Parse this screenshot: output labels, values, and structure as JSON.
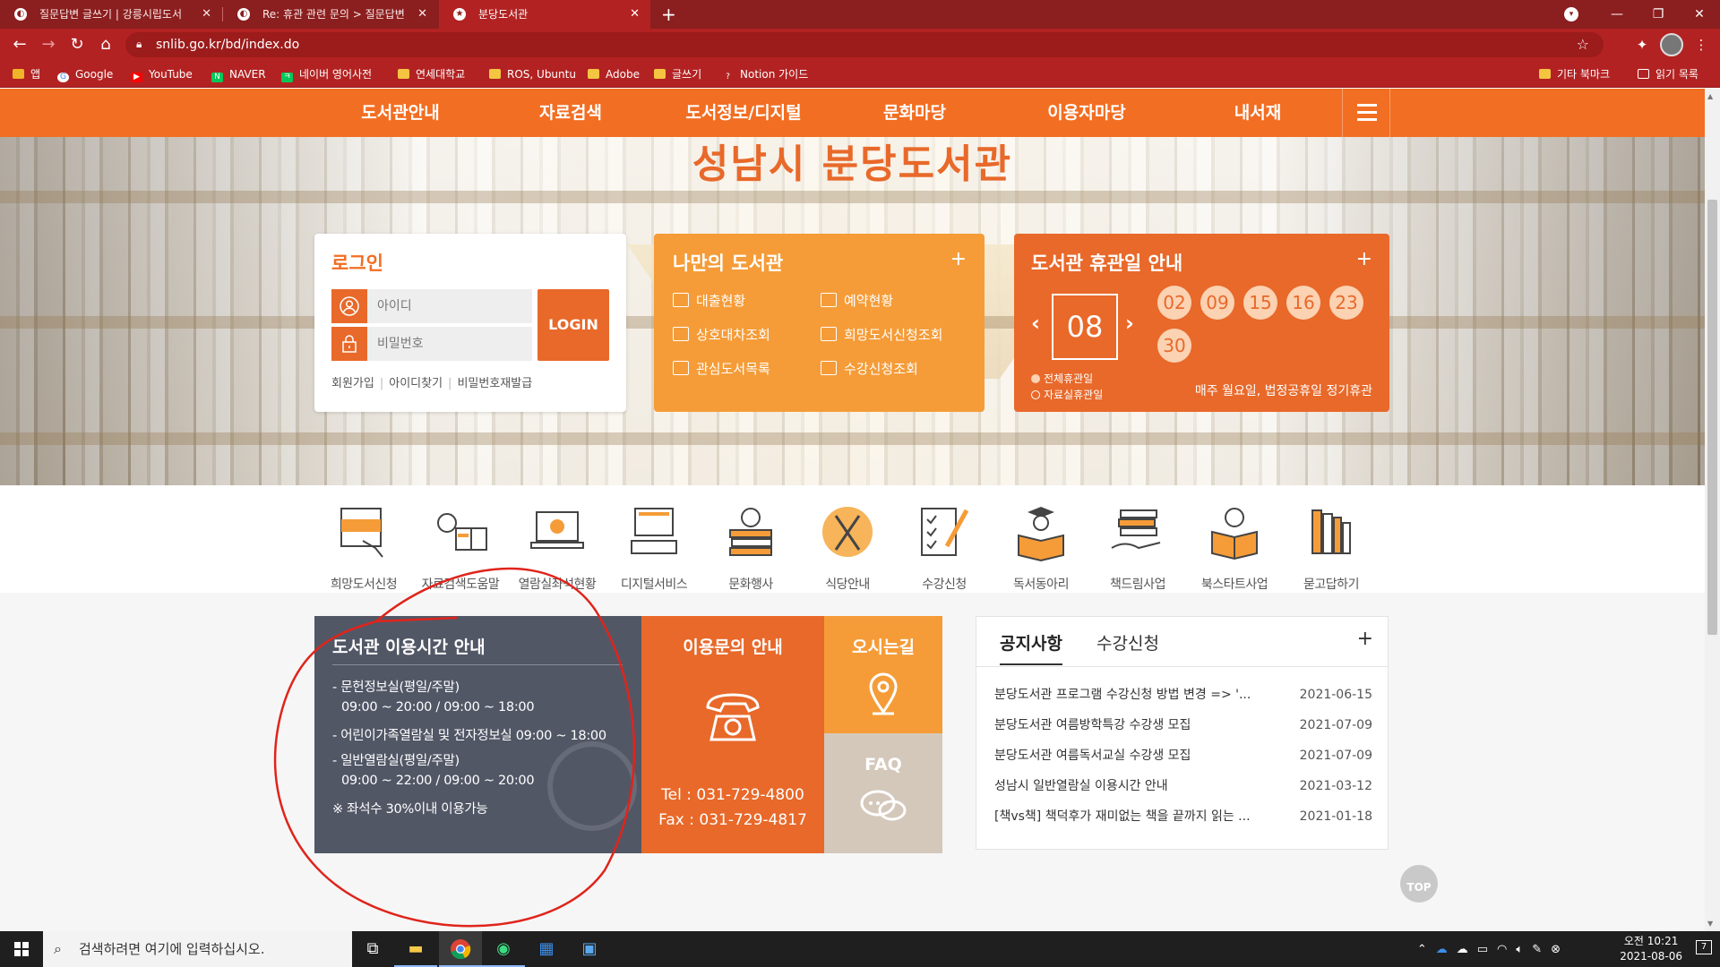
{
  "browser": {
    "tabs": [
      {
        "title": "질문답변 글쓰기 | 강릉시립도서",
        "active": false
      },
      {
        "title": "Re: 휴관 관련 문의 > 질문답변",
        "active": false
      },
      {
        "title": "분당도서관",
        "active": true
      }
    ],
    "url": "snlib.go.kr/bd/index.do",
    "bookmarks": [
      "앱",
      "Google",
      "YouTube",
      "NAVER",
      "네이버 영어사전",
      "연세대학교",
      "ROS, Ubuntu",
      "Adobe",
      "글쓰기",
      "Notion 가이드"
    ],
    "bookmarks_right": [
      "기타 북마크",
      "읽기 목록"
    ]
  },
  "site": {
    "title": "성남시 분당도서관",
    "nav": [
      "도서관안내",
      "자료검색",
      "도서정보/디지털",
      "문화마당",
      "이용자마당",
      "내서재"
    ]
  },
  "login": {
    "title": "로그인",
    "id_placeholder": "아이디",
    "pw_placeholder": "비밀번호",
    "button": "LOGIN",
    "links": [
      "회원가입",
      "아이디찾기",
      "비밀번호재발급"
    ]
  },
  "mylib": {
    "title": "나만의 도서관",
    "plus": "+",
    "links": [
      "대출현황",
      "예약현황",
      "상호대차조회",
      "희망도서신청조회",
      "관심도서목록",
      "수강신청조회"
    ]
  },
  "holiday": {
    "title": "도서관 휴관일 안내",
    "plus": "+",
    "month": "08",
    "days": [
      "02",
      "09",
      "15",
      "16",
      "23",
      "30"
    ],
    "legend": [
      "전체휴관일",
      "자료실휴관일"
    ],
    "note": "매주 월요일, 법정공휴일 정기휴관"
  },
  "quick_menu": [
    "희망도서신청",
    "자료검색도움말",
    "열람실좌석현황",
    "디지털서비스",
    "문화행사",
    "식당안내",
    "수강신청",
    "독서동아리",
    "책드림사업",
    "북스타트사업",
    "묻고답하기"
  ],
  "hours": {
    "title": "도서관 이용시간 안내",
    "lines": [
      "- 문헌정보실(평일/주말)",
      "09:00 ~ 20:00 / 09:00 ~ 18:00",
      "- 어린이가족열람실 및 전자정보실  09:00 ~ 18:00",
      "- 일반열람실(평일/주말)",
      "09:00 ~ 22:00 / 09:00 ~ 20:00",
      "※ 좌석수 30%이내 이용가능"
    ]
  },
  "contact": {
    "title": "이용문의 안내",
    "tel": "Tel : 031-729-4800",
    "fax": "Fax : 031-729-4817"
  },
  "directions": {
    "title": "오시는길"
  },
  "faq": {
    "title": "FAQ"
  },
  "notice": {
    "tabs": [
      "공지사항",
      "수강신청"
    ],
    "plus": "+",
    "items": [
      {
        "title": "분당도서관 프로그램 수강신청 방법 변경 => '...",
        "date": "2021-06-15"
      },
      {
        "title": "분당도서관 여름방학특강 수강생 모집",
        "date": "2021-07-09"
      },
      {
        "title": "분당도서관 여름독서교실 수강생 모집",
        "date": "2021-07-09"
      },
      {
        "title": "성남시 일반열람실 이용시간 안내",
        "date": "2021-03-12"
      },
      {
        "title": "[책vs책] 책덕후가 재미없는 책을 끝까지 읽는 ...",
        "date": "2021-01-18"
      }
    ]
  },
  "top_button": "TOP",
  "taskbar": {
    "search_placeholder": "검색하려면 여기에 입력하십시오.",
    "time": "오전 10:21",
    "date": "2021-08-06",
    "notification_count": "7"
  },
  "colors": {
    "orange": "#f26e22",
    "dark_orange": "#e8692a",
    "light_orange": "#f59c38",
    "slate": "#525766",
    "browser_red": "#b32222"
  }
}
